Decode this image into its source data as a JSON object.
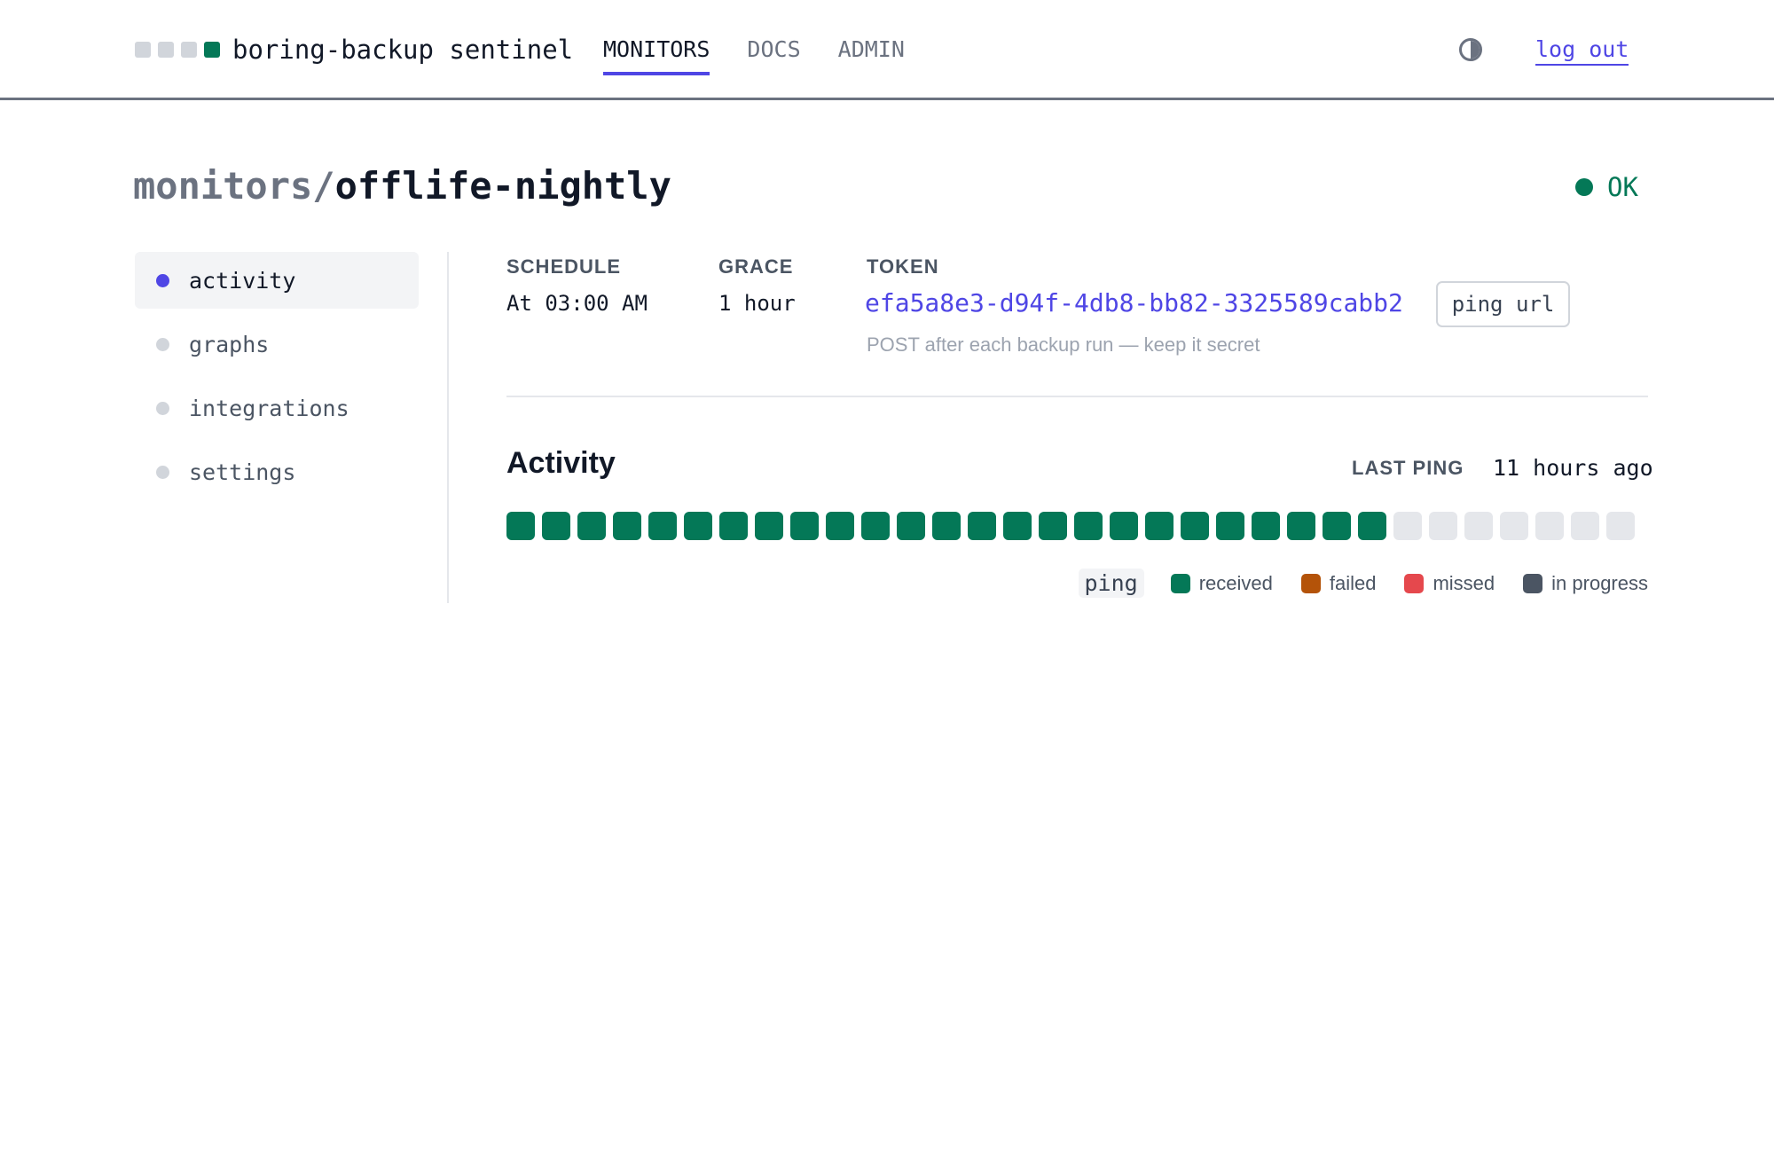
{
  "header": {
    "brand": "boring-backup sentinel",
    "nav": [
      {
        "label": "MONITORS",
        "active": true
      },
      {
        "label": "DOCS",
        "active": false
      },
      {
        "label": "ADMIN",
        "active": false
      }
    ],
    "theme_icon": "contrast-icon",
    "logout": "log out"
  },
  "title": {
    "prefix": "monitors/",
    "name": "offlife-nightly"
  },
  "status": {
    "label": "OK",
    "color": "#047857"
  },
  "sidebar": {
    "items": [
      {
        "label": "activity",
        "active": true
      },
      {
        "label": "graphs",
        "active": false
      },
      {
        "label": "integrations",
        "active": false
      },
      {
        "label": "settings",
        "active": false
      }
    ]
  },
  "details": {
    "schedule_label": "SCHEDULE",
    "schedule_value": "At 03:00 AM",
    "grace_label": "GRACE",
    "grace_value": "1 hour",
    "token_label": "TOKEN",
    "token_value": "efa5a8e3-d94f-4db8-bb82-3325589cabb2",
    "ping_url_button": "ping url",
    "token_hint": "POST after each backup run — keep it secret"
  },
  "activity": {
    "title": "Activity",
    "last_ping_label": "LAST PING",
    "last_ping_value": "11 hours ago",
    "pings": [
      "received",
      "received",
      "received",
      "received",
      "received",
      "received",
      "received",
      "received",
      "received",
      "received",
      "received",
      "received",
      "received",
      "received",
      "received",
      "received",
      "received",
      "received",
      "received",
      "received",
      "received",
      "received",
      "received",
      "received",
      "received",
      "empty",
      "empty",
      "empty",
      "empty",
      "empty",
      "empty",
      "empty"
    ],
    "legend_tag": "ping",
    "legend": [
      {
        "key": "received",
        "label": "received",
        "color": "#047857"
      },
      {
        "key": "failed",
        "label": "failed",
        "color": "#b45309"
      },
      {
        "key": "missed",
        "label": "missed",
        "color": "#e5484d"
      },
      {
        "key": "in_progress",
        "label": "in progress",
        "color": "#4b5563"
      }
    ],
    "empty_color": "#e5e7eb"
  }
}
